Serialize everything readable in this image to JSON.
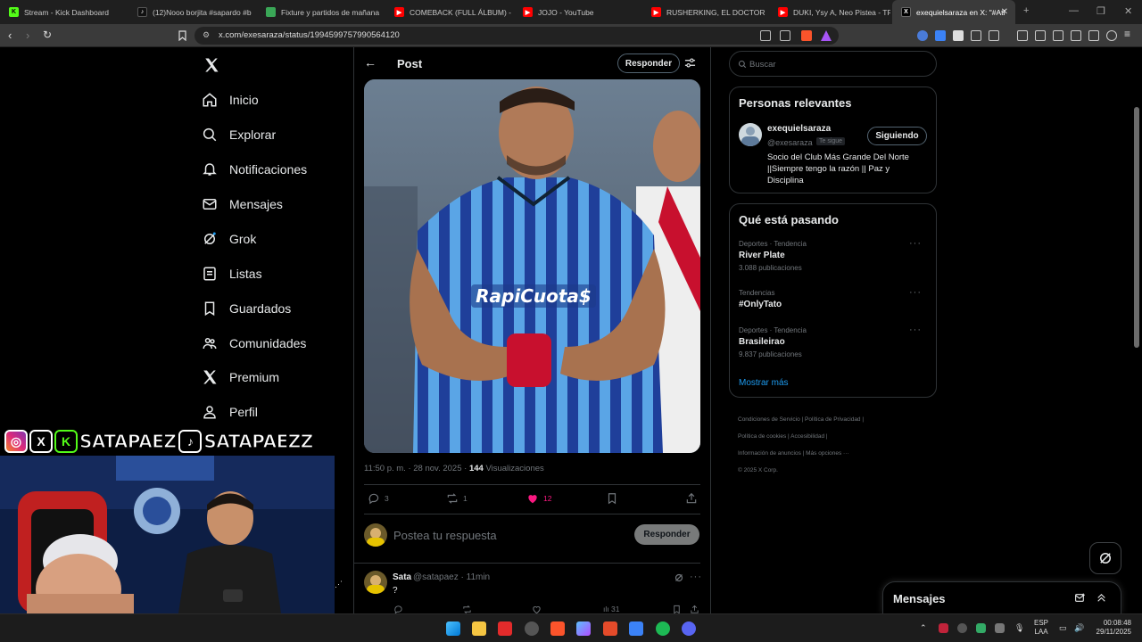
{
  "tabs": [
    {
      "title": "Stream - Kick Dashboard",
      "favicon": "kick-icon",
      "color": "#53fc18"
    },
    {
      "title": "(12)Nooo borjita #sapardo #b",
      "favicon": "tiktok-icon",
      "color": "#111111"
    },
    {
      "title": "Fixture y partidos de mañana",
      "favicon": "shield-icon",
      "color": "#3aa757"
    },
    {
      "title": "COMEBACK (FULL ÁLBUM) - Y",
      "favicon": "youtube-icon",
      "color": "#ff0000"
    },
    {
      "title": "JOJO - YouTube",
      "favicon": "youtube-icon",
      "color": "#ff0000"
    },
    {
      "title": "RUSHERKING, EL DOCTOR & I",
      "favicon": "youtube-icon",
      "color": "#ff0000"
    },
    {
      "title": "DUKI, Ysy A, Neo Pistea - TRAF",
      "favicon": "youtube-icon",
      "color": "#ff0000"
    },
    {
      "title": "exequielsaraza en X: \"#Atl",
      "favicon": "x-icon",
      "color": "#000000"
    }
  ],
  "address": {
    "url": "x.com/exesaraza/status/1994599757990564120"
  },
  "nav": {
    "items": [
      {
        "label": "Inicio",
        "icon": "home-icon"
      },
      {
        "label": "Explorar",
        "icon": "search-icon"
      },
      {
        "label": "Notificaciones",
        "icon": "bell-icon"
      },
      {
        "label": "Mensajes",
        "icon": "mail-icon"
      },
      {
        "label": "Grok",
        "icon": "grok-icon"
      },
      {
        "label": "Listas",
        "icon": "list-icon"
      },
      {
        "label": "Guardados",
        "icon": "bookmark-icon"
      },
      {
        "label": "Comunidades",
        "icon": "communities-icon"
      },
      {
        "label": "Premium",
        "icon": "x-icon"
      },
      {
        "label": "Perfil",
        "icon": "profile-icon"
      }
    ]
  },
  "post": {
    "header_title": "Post",
    "reply_button": "Responder",
    "time": "11:50 p. m. · 28 nov. 2025 · ",
    "views_count": "144",
    "views_label": " Visualizaciones",
    "replies": "3",
    "reposts": "1",
    "likes": "12",
    "compose_placeholder": "Postea tu respuesta",
    "compose_button": "Responder"
  },
  "reply": {
    "name": "Sata",
    "handle": "@satapaez · 11min",
    "text": "?",
    "views": "31"
  },
  "search": {
    "placeholder": "Buscar"
  },
  "relevant": {
    "title": "Personas relevantes",
    "name": "exequielsaraza",
    "handle": "@exesaraza",
    "follows_you": "Te sigue",
    "button": "Siguiendo",
    "bio": "Socio del Club Más Grande Del Norte ||Siempre tengo la razón || Paz y Disciplina"
  },
  "trends": {
    "title": "Qué está pasando",
    "items": [
      {
        "category": "Deportes · Tendencia",
        "name": "River Plate",
        "count": "3.088 publicaciones"
      },
      {
        "category": "Tendencias",
        "name": "#OnlyTato",
        "count": ""
      },
      {
        "category": "Deportes · Tendencia",
        "name": "Brasileirao",
        "count": "9.837 publicaciones"
      }
    ],
    "more": "Mostrar más"
  },
  "footer": {
    "l1": "Condiciones de Servicio",
    "l2": "Política de Privacidad",
    "l3": "Política de cookies",
    "l4": "Accesibilidad",
    "l5": "Información de anuncios",
    "l6": "Más opciones ···",
    "copy": "© 2025 X Corp."
  },
  "messages_drawer": {
    "title": "Mensajes"
  },
  "overlay": {
    "handle1": "SATAPAEZ",
    "handle2": "SATAPAEZZ"
  },
  "taskbar": {
    "lang1": "ESP",
    "lang2": "LAA",
    "time": "00:08:48",
    "date": "29/11/2025"
  },
  "colors": {
    "like": "#f91880",
    "accent": "#1d9bf0",
    "bg": "#000000"
  }
}
